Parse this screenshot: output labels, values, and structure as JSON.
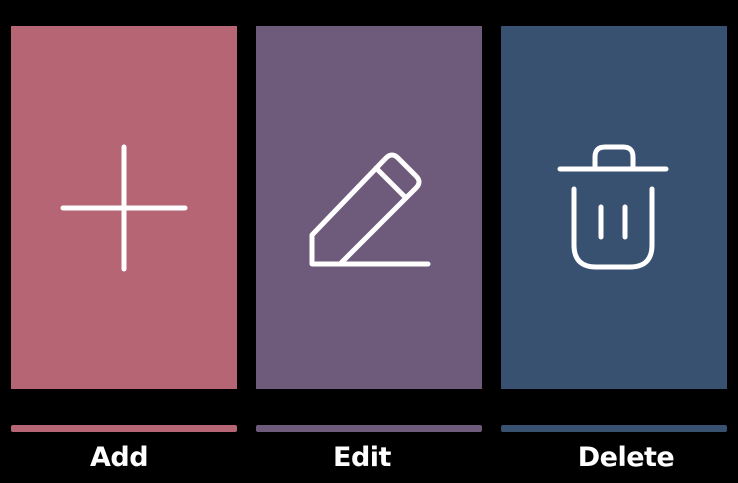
{
  "colors": {
    "background": "#000000",
    "icon_stroke": "#ffffff",
    "add": "#b66575",
    "edit": "#6e5b7b",
    "delete": "#395170"
  },
  "actions": [
    {
      "id": "add",
      "label": "Add",
      "icon": "plus-icon"
    },
    {
      "id": "edit",
      "label": "Edit",
      "icon": "pencil-icon"
    },
    {
      "id": "delete",
      "label": "Delete",
      "icon": "trash-icon"
    }
  ]
}
